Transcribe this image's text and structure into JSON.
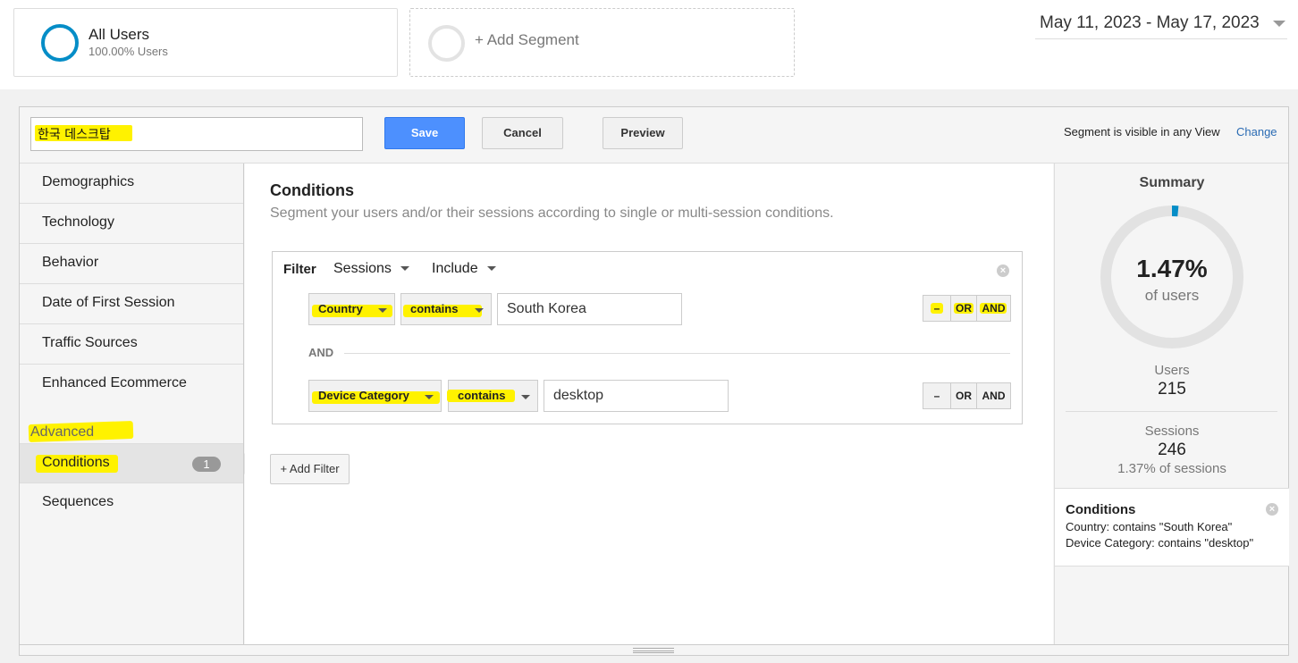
{
  "top": {
    "segment_name": "All Users",
    "segment_sub": "100.00% Users",
    "add_segment": "+ Add Segment",
    "date_range": "May 11, 2023 - May 17, 2023"
  },
  "editor": {
    "segment_name_value": "한국 데스크탑",
    "save": "Save",
    "cancel": "Cancel",
    "preview": "Preview",
    "visible_note": "Segment is visible in any View",
    "change": "Change"
  },
  "sidebar": {
    "items": [
      "Demographics",
      "Technology",
      "Behavior",
      "Date of First Session",
      "Traffic Sources",
      "Enhanced Ecommerce"
    ],
    "advanced_label": "Advanced",
    "advanced_items": [
      "Conditions",
      "Sequences"
    ],
    "conditions_count": "1"
  },
  "main": {
    "title": "Conditions",
    "description": "Segment your users and/or their sessions according to single or multi-session conditions.",
    "filter_label": "Filter",
    "scope": "Sessions",
    "include": "Include",
    "rows": [
      {
        "dimension": "Country",
        "operator": "contains",
        "value": "South Korea"
      },
      {
        "dimension": "Device Category",
        "operator": "contains",
        "value": "desktop"
      }
    ],
    "and_separator": "AND",
    "bool_minus": "–",
    "bool_or": "OR",
    "bool_and": "AND",
    "add_filter": "+ Add Filter"
  },
  "summary": {
    "title": "Summary",
    "percent": "1.47%",
    "percent_sub": "of users",
    "percent_value": 1.47,
    "users_label": "Users",
    "users_value": "215",
    "sessions_label": "Sessions",
    "sessions_value": "246",
    "sessions_pct": "1.37% of sessions",
    "conditions_title": "Conditions",
    "conditions_lines": [
      "Country: contains \"South Korea\"",
      "Device Category: contains \"desktop\""
    ]
  },
  "colors": {
    "accent": "#058dc7",
    "save_button": "#4d90fe",
    "highlight": "#fff200",
    "link": "#2a6bb3"
  }
}
